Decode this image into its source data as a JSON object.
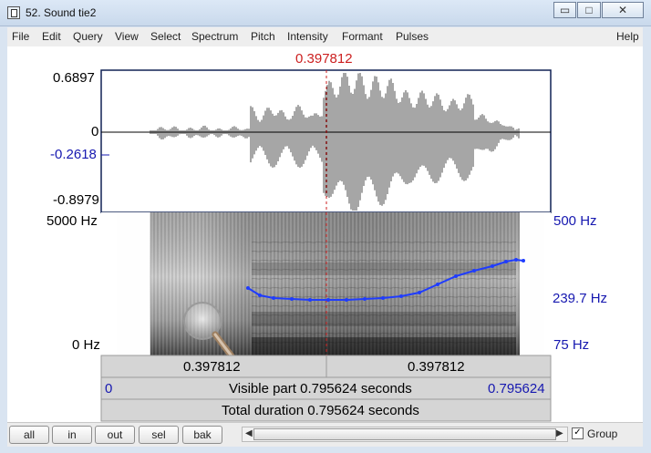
{
  "window": {
    "title": "52. Sound tie2"
  },
  "menu": [
    "File",
    "Edit",
    "Query",
    "View",
    "Select",
    "Spectrum",
    "Pitch",
    "Intensity",
    "Formant",
    "Pulses",
    "Help"
  ],
  "cursor": {
    "time_label": "0.397812"
  },
  "waveform": {
    "top_label": "0.6897",
    "zero_label": "0",
    "marker_label": "-0.2618",
    "bottom_label": "-0.8979"
  },
  "spectrogram": {
    "left_top_label": "5000 Hz",
    "left_bottom_label": "0 Hz",
    "right_top_label": "500 Hz",
    "right_mid_label": "239.7 Hz",
    "right_bottom_label": "75 Hz"
  },
  "times": {
    "left_segment": "0.397812",
    "right_segment": "0.397812",
    "visible_start": "0",
    "visible_text": "Visible part 0.795624 seconds",
    "visible_end": "0.795624",
    "total_text": "Total duration 0.795624 seconds"
  },
  "bottom": {
    "buttons": [
      "all",
      "in",
      "out",
      "sel",
      "bak"
    ],
    "group_label": "Group",
    "group_checked": true
  },
  "colors": {
    "accent_red": "#cc1f1f",
    "accent_blue": "#1618b0",
    "pitch_blue": "#1f3cff"
  },
  "icons": {
    "app": "sound-window-icon",
    "minimize": "minimize-icon",
    "maximize": "maximize-icon",
    "close": "close-icon",
    "scroll_left": "left-arrow-icon",
    "scroll_right": "right-arrow-icon",
    "check": "checkmark-icon"
  }
}
